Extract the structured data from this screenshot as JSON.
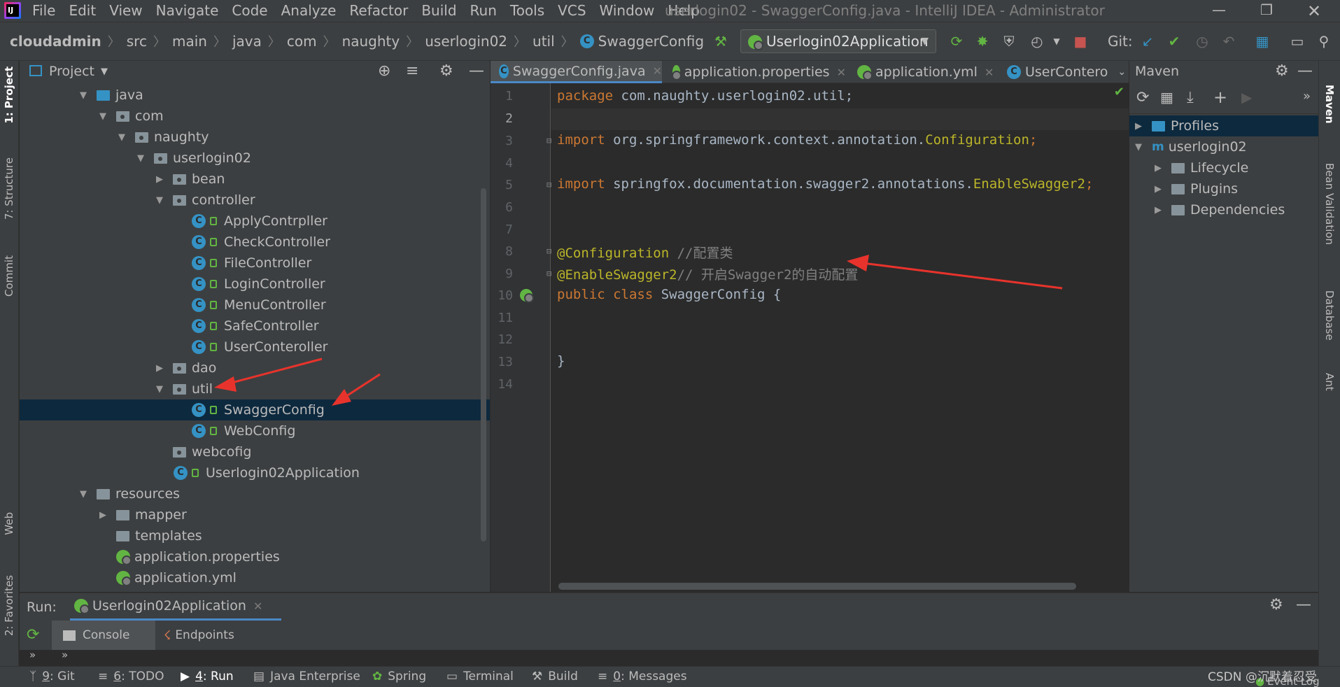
{
  "menu": {
    "items": [
      "File",
      "Edit",
      "View",
      "Navigate",
      "Code",
      "Analyze",
      "Refactor",
      "Build",
      "Run",
      "Tools",
      "VCS",
      "Window",
      "Help"
    ]
  },
  "window_title": "userlogin02 - SwaggerConfig.java - IntelliJ IDEA - Administrator",
  "breadcrumb": [
    "cloudadmin",
    "src",
    "main",
    "java",
    "com",
    "naughty",
    "userlogin02",
    "util",
    "SwaggerConfig"
  ],
  "run_config": "Userlogin02Application",
  "git_label": "Git:",
  "project_panel": {
    "title": "Project"
  },
  "tree": [
    {
      "label": "java",
      "type": "folder-src"
    },
    {
      "label": "com",
      "type": "package"
    },
    {
      "label": "naughty",
      "type": "package"
    },
    {
      "label": "userlogin02",
      "type": "package"
    },
    {
      "label": "bean",
      "type": "package"
    },
    {
      "label": "controller",
      "type": "package"
    },
    {
      "label": "ApplyContrpller",
      "type": "class"
    },
    {
      "label": "CheckController",
      "type": "class"
    },
    {
      "label": "FileController",
      "type": "class"
    },
    {
      "label": "LoginController",
      "type": "class"
    },
    {
      "label": "MenuController",
      "type": "class"
    },
    {
      "label": "SafeController",
      "type": "class"
    },
    {
      "label": "UserConteroller",
      "type": "class"
    },
    {
      "label": "dao",
      "type": "package"
    },
    {
      "label": "util",
      "type": "package"
    },
    {
      "label": "SwaggerConfig",
      "type": "class"
    },
    {
      "label": "WebConfig",
      "type": "class"
    },
    {
      "label": "webcofig",
      "type": "package"
    },
    {
      "label": "Userlogin02Application",
      "type": "spring-class"
    },
    {
      "label": "resources",
      "type": "folder-res"
    },
    {
      "label": "mapper",
      "type": "folder"
    },
    {
      "label": "templates",
      "type": "folder"
    },
    {
      "label": "application.properties",
      "type": "spring-file"
    },
    {
      "label": "application.yml",
      "type": "spring-file"
    }
  ],
  "tabs": [
    "SwaggerConfig.java",
    "application.properties",
    "application.yml",
    "UserContero"
  ],
  "line_numbers": [
    "1",
    "2",
    "3",
    "4",
    "5",
    "6",
    "7",
    "8",
    "9",
    "10",
    "11",
    "12",
    "13",
    "14"
  ],
  "code": {
    "l1_kw": "package",
    "l1_rest": " com.naughty.userlogin02.util;",
    "l3_kw": "import",
    "l3_rest": " org.springframework.context.annotation.",
    "l3_ann": "Configuration",
    "l3_end": ";",
    "l5_kw": "import",
    "l5_rest": " springfox.documentation.swagger2.annotations.",
    "l5_ann": "EnableSwagger2",
    "l5_end": ";",
    "l8_ann": "@Configuration",
    "l8_cm": " //配置类",
    "l9_ann": "@EnableSwagger2",
    "l9_cm": "// 开启Swagger2的自动配置",
    "l10_kw1": "public",
    "l10_kw2": "class",
    "l10_rest": " SwaggerConfig {",
    "l13": "}"
  },
  "maven": {
    "title": "Maven",
    "items": [
      "Profiles",
      "userlogin02",
      "Lifecycle",
      "Plugins",
      "Dependencies"
    ]
  },
  "left_strip": [
    "1: Project",
    "7: Structure",
    "Commit",
    "Web",
    "2: Favorites"
  ],
  "right_strip": [
    "Maven",
    "Bean Validation",
    "Database",
    "Ant"
  ],
  "run_panel": {
    "label": "Run:",
    "config": "Userlogin02Application",
    "tabs": [
      "Console",
      "Endpoints"
    ]
  },
  "status": [
    {
      "num": "9",
      "label": ": Git"
    },
    {
      "num": "6",
      "label": ": TODO"
    },
    {
      "num": "4",
      "label": ": Run"
    },
    {
      "num": "",
      "label": "Java Enterprise"
    },
    {
      "num": "",
      "label": "Spring"
    },
    {
      "num": "",
      "label": "Terminal"
    },
    {
      "num": "",
      "label": "Build"
    },
    {
      "num": "0",
      "label": ": Messages"
    }
  ],
  "watermark": "CSDN @沉默着忍受",
  "event_log": "Event Log",
  "colors": {
    "accent": "#4a88c7",
    "selection": "#0d293e",
    "arrow": "#e8332c",
    "spring": "#62b543",
    "class": "#3592c4"
  }
}
